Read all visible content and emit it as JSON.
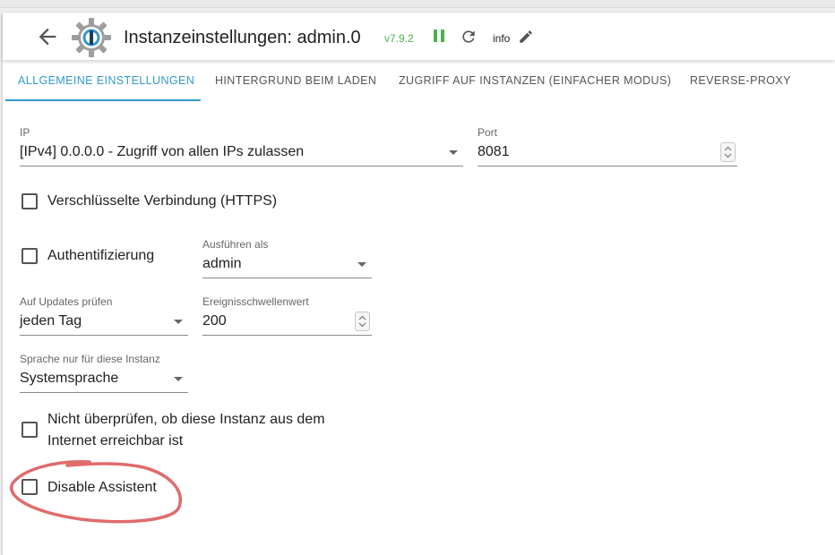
{
  "header": {
    "title": "Instanzeinstellungen: admin.0",
    "version": "v7.9.2",
    "info": "info"
  },
  "tabs": [
    {
      "label": "Allgemeine Einstellungen",
      "active": true
    },
    {
      "label": "Hintergrund beim Laden",
      "active": false
    },
    {
      "label": "Zugriff auf Instanzen (einfacher Modus)",
      "active": false
    },
    {
      "label": "Reverse-Proxy",
      "active": false
    }
  ],
  "form": {
    "ip": {
      "label": "IP",
      "value": "[IPv4] 0.0.0.0 - Zugriff von allen IPs zulassen"
    },
    "port": {
      "label": "Port",
      "value": "8081"
    },
    "https": {
      "label": "Verschlüsselte Verbindung (HTTPS)",
      "checked": false
    },
    "auth": {
      "label": "Authentifizierung",
      "checked": false
    },
    "run_as": {
      "label": "Ausführen als",
      "value": "admin"
    },
    "updates": {
      "label": "Auf Updates prüfen",
      "value": "jeden Tag"
    },
    "threshold": {
      "label": "Ereignisschwellenwert",
      "value": "200"
    },
    "language": {
      "label": "Sprache nur für diese Instanz",
      "value": "Systemsprache"
    },
    "no_check": {
      "label_line1": "Nicht überprüfen, ob diese Instanz aus dem",
      "label_line2": "Internet erreichbar ist",
      "checked": false
    },
    "disable_assistant": {
      "label": "Disable Assistent",
      "checked": false
    }
  },
  "colors": {
    "accent": "#3399cc",
    "version": "#4caf50",
    "annotation": "#e06b6b"
  }
}
